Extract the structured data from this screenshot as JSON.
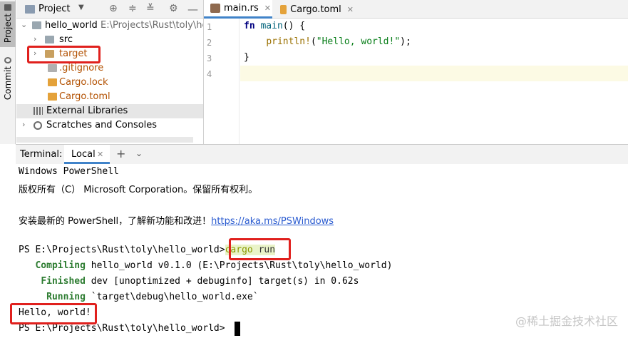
{
  "sidebar": {
    "project_tab_label": "Project",
    "commit_tab_label": "Commit"
  },
  "project_panel": {
    "title": "Project",
    "tree": {
      "root_name": "hello_world",
      "root_path": "E:\\Projects\\Rust\\toly\\hell",
      "src": "src",
      "target": "target",
      "gitignore": ".gitignore",
      "cargo_lock": "Cargo.lock",
      "cargo_toml": "Cargo.toml",
      "external_libraries": "External Libraries",
      "scratches": "Scratches and Consoles"
    }
  },
  "editor": {
    "tabs": [
      {
        "label": "main.rs",
        "active": true
      },
      {
        "label": "Cargo.toml",
        "active": false
      }
    ],
    "line_numbers": [
      "1",
      "2",
      "3",
      "4"
    ],
    "code": {
      "fn_kw": "fn",
      "fn_name": "main",
      "fn_rest": "() {",
      "macro": "println!",
      "paren_open": "(",
      "string": "\"Hello, world!\"",
      "paren_close": ");",
      "close_brace": "}"
    }
  },
  "terminal": {
    "title": "Terminal:",
    "tab_label": "Local",
    "lines": {
      "l1": "Windows PowerShell",
      "l2": "版权所有（C） Microsoft Corporation。保留所有权利。",
      "l3_prefix": "安装最新的 PowerShell，了解新功能和改进！",
      "l3_link": "https://aka.ms/PSWindows",
      "prompt1": "PS E:\\Projects\\Rust\\toly\\hello_world>",
      "cmd": "cargo",
      "cmd_arg": "run",
      "compiling_kw": "Compiling",
      "compiling_rest": "hello_world v0.1.0 (E:\\Projects\\Rust\\toly\\hello_world)",
      "finished_kw": "Finished",
      "finished_rest": "dev [unoptimized + debuginfo] target(s) in 0.62s",
      "running_kw": "Running",
      "running_rest": "`target\\debug\\hello_world.exe`",
      "output": "Hello, world!",
      "prompt2": "PS E:\\Projects\\Rust\\toly\\hello_world>"
    }
  },
  "watermark": "@稀土掘金技术社区",
  "colors": {
    "highlight_box": "#e0201d",
    "cargo_green": "#2e7d32",
    "link_blue": "#2a5bd0",
    "tab_underline": "#4083c9"
  }
}
